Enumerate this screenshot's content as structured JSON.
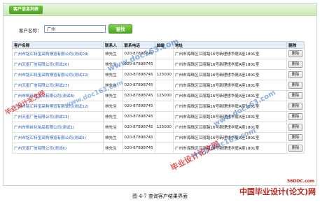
{
  "header": {
    "title": "客户信息列表"
  },
  "search": {
    "label": "客户名称：",
    "value": "广州",
    "button_label": "查找"
  },
  "table": {
    "columns": [
      "客户名称",
      "联系人",
      "联系电话",
      "邮编",
      "地址",
      "删除"
    ],
    "rows": [
      {
        "name": "广州市铭汇特宝采购博览有限公司(测试09)",
        "contact": "林先生",
        "phone": "020-87898745",
        "postcode": "",
        "address": "广州市海珠区江丽路16号新理想华庭A座1801室",
        "delete": "删除"
      },
      {
        "name": "广州天墨厂信有限公司(测试20)",
        "contact": "林先生",
        "phone": "020-87898745",
        "postcode": "",
        "address": "广州市海珠区江丽路16号新理想华庭A座1801室",
        "delete": "删除"
      },
      {
        "name": "广州市铭汇特宝采购博览有限公司(测试22)",
        "contact": "林先生",
        "phone": "020-87898745",
        "postcode": "125000",
        "address": "广州市海珠区江丽路16号新理想华庭A座1801室",
        "delete": "删除"
      },
      {
        "name": "广州天墨厂信有限公司(测试27)",
        "contact": "林先生",
        "phone": "020-87898745",
        "postcode": "",
        "address": "广州市海珠区江丽路16号新理想华庭A座1801室",
        "delete": "删除"
      },
      {
        "name": "广州市恒丝化妆品有限公司(测试8)",
        "contact": "林先生",
        "phone": "020-87898745",
        "postcode": "125000",
        "address": "广州市海珠区江丽路16号新理想华庭A座1801室",
        "delete": "删除"
      },
      {
        "name": "广州市铭汇特宝采购博览有限公司(测试12)",
        "contact": "林先生",
        "phone": "020-87898745",
        "postcode": "",
        "address": "广州市海珠区江丽路16号新理想华庭A座1801室",
        "delete": "删除"
      },
      {
        "name": "广州天墨厂信有限公司(测试13)",
        "contact": "林先生",
        "phone": "020-87898745",
        "postcode": "",
        "address": "广州市海珠区江丽路16号新理想华庭A座1801室",
        "delete": "删除"
      },
      {
        "name": "广州市恒丝化妆品有限公司(测试1)",
        "contact": "林先生",
        "phone": "020-87898745",
        "postcode": "125000",
        "address": "广州市海珠区江丽路16号新理想华庭A座1801室",
        "delete": "删除"
      },
      {
        "name": "广州市铭汇特宝采购博览有限公司(测试5)",
        "contact": "林先生",
        "phone": "020-87898745",
        "postcode": "",
        "address": "广州市海珠区江丽路16号新理想华庭A座1801室",
        "delete": "删除"
      },
      {
        "name": "广州天墨厂信有限公司(测试6)",
        "contact": "林先生",
        "phone": "020-87898745",
        "postcode": "",
        "address": "广州市海珠区江丽路16号新理想华庭A座1801室",
        "delete": "删除"
      }
    ]
  },
  "caption": "图 4-7  查询客户结果界面",
  "watermarks": {
    "text1": "www.doc163.com",
    "text2": "毕业设计论文网",
    "text3": "www.doc163.com",
    "text4": "毕业设计论文网",
    "text5": "www.doc163.com",
    "text6": "www.doc163.com",
    "site_url": "56DOC.com",
    "site_logo": "中国毕业设计(论文)网"
  },
  "colors": {
    "header_green": "#4ea126",
    "link_blue": "#1f58b4",
    "table_header_bg": "#e4eef9",
    "watermark_red": "#c0281f"
  }
}
